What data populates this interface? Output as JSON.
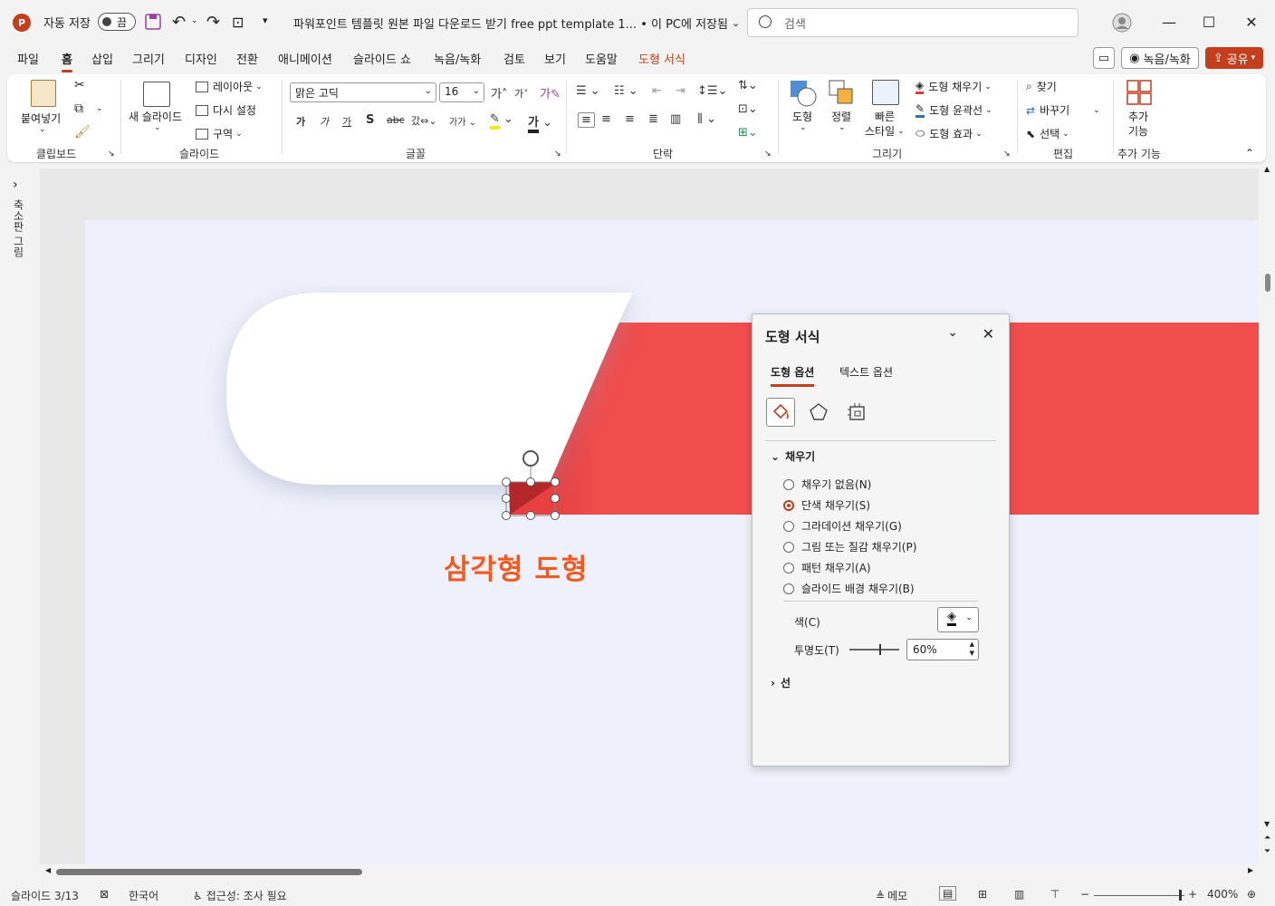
{
  "titlebar": {
    "autosave_label": "자동 저장",
    "autosave_state": "끔",
    "document_title": "파워포인트 템플릿 원본 파일 다운로드 받기 free ppt template 1... • 이 PC에 저장됨",
    "search_placeholder": "검색"
  },
  "menu": {
    "tabs": [
      "파일",
      "홈",
      "삽입",
      "그리기",
      "디자인",
      "전환",
      "애니메이션",
      "슬라이드 쇼",
      "녹음/녹화",
      "검토",
      "보기",
      "도움말",
      "도형 서식"
    ],
    "active_tab": "홈",
    "record_button": "녹음/녹화",
    "share_button": "공유"
  },
  "ribbon": {
    "clipboard": {
      "paste": "붙여넣기",
      "label": "클립보드"
    },
    "slides": {
      "new_slide": "새 슬라이드",
      "layout": "레이아웃",
      "reset": "다시 설정",
      "section": "구역",
      "label": "슬라이드"
    },
    "font": {
      "font_name": "맑은 고딕",
      "font_size": "16",
      "label": "글꼴"
    },
    "paragraph": {
      "label": "단락"
    },
    "drawing": {
      "shapes": "도형",
      "arrange": "정렬",
      "quick_styles_1": "빠른",
      "quick_styles_2": "스타일",
      "shape_fill": "도형 채우기",
      "shape_outline": "도형 윤곽선",
      "shape_effects": "도형 효과",
      "label": "그리기"
    },
    "editing": {
      "find": "찾기",
      "replace": "바꾸기",
      "select": "선택",
      "label": "편집"
    },
    "addins": {
      "addins_1": "추가",
      "addins_2": "기능",
      "label": "추가 기능"
    }
  },
  "thumb_panel": {
    "label": "축소판 그림"
  },
  "slide": {
    "caption": "삼각형 도형"
  },
  "format_pane": {
    "title": "도형 서식",
    "tabs": [
      "도형 옵션",
      "텍스트 옵션"
    ],
    "fill_section": "채우기",
    "fill_options": [
      "채우기 없음(N)",
      "단색 채우기(S)",
      "그라데이션 채우기(G)",
      "그림 또는 질감 채우기(P)",
      "패턴 채우기(A)",
      "슬라이드 배경 채우기(B)"
    ],
    "selected_fill": 1,
    "color_label": "색(C)",
    "transparency_label": "투명도(T)",
    "transparency_value": "60%",
    "transparency_fraction": 0.6,
    "line_section": "선"
  },
  "statusbar": {
    "slide_info": "슬라이드 3/13",
    "language": "한국어",
    "accessibility": "접근성: 조사 필요",
    "notes": "메모",
    "zoom": "400%"
  },
  "colors": {
    "accent": "#c43e1c",
    "slide_band": "#f04d4d",
    "caption": "#f35a1e",
    "slide_bg": "#eef1fb"
  }
}
